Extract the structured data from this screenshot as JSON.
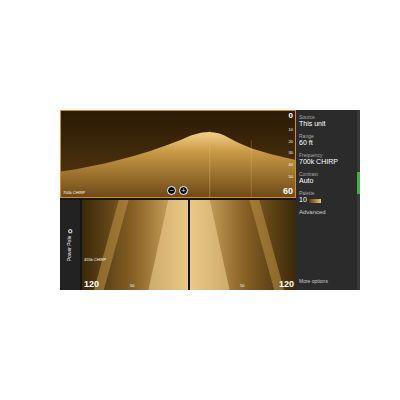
{
  "top_panel": {
    "label": "700k CHIRP",
    "scale_top": "0",
    "scale_ticks": [
      "10",
      "20",
      "30",
      "40",
      "50"
    ],
    "scale_bottom": "60",
    "zoom_buttons": [
      "−",
      "+"
    ]
  },
  "side_panels": {
    "label": "455k CHIRP",
    "left_range": "120",
    "left_mid": "50",
    "right_mid": "50",
    "right_range": "120"
  },
  "sidebar": {
    "label": "Power Pole"
  },
  "menu": {
    "items": [
      {
        "label": "Source",
        "value": "This unit",
        "kind": "value"
      },
      {
        "label": "Range",
        "value": "60 ft",
        "kind": "value"
      },
      {
        "label": "Frequency",
        "value": "700k CHIRP",
        "kind": "value"
      },
      {
        "label": "Contrast",
        "value": "Auto",
        "kind": "value"
      },
      {
        "label": "Palette",
        "value": "10",
        "kind": "palette"
      },
      {
        "label": "Advanced",
        "value": "",
        "kind": "link"
      }
    ],
    "more": "More options"
  }
}
